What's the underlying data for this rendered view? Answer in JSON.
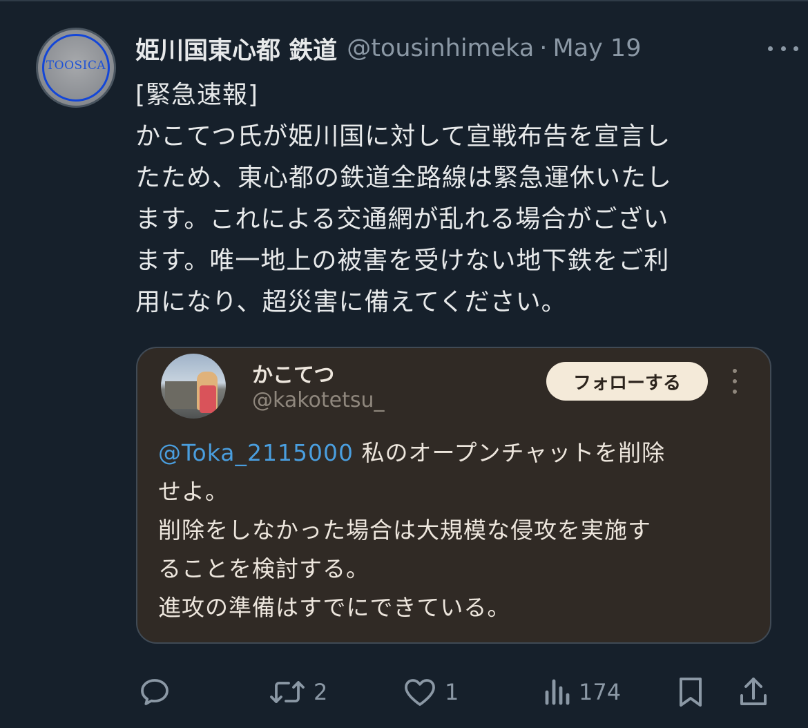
{
  "tweet": {
    "avatar_text": "TOOSICA",
    "display_name": "姫川国東心都 鉄道",
    "handle": "@tousinhimeka",
    "separator": "·",
    "date": "May 19",
    "lines": [
      "[緊急速報]",
      "かこてつ氏が姫川国に対して宣戦布告を宣言し",
      "たため、東心都の鉄道全路線は緊急運休いたし",
      "ます。これによる交通網が乱れる場合がござい",
      "ます。唯一地上の被害を受けない地下鉄をご利",
      "用になり、超災害に備えてください。"
    ]
  },
  "embed": {
    "name": "かこてつ",
    "handle": "@kakotetsu_",
    "follow_label": "フォローする",
    "mention": "@Toka_2115000",
    "first_line_rest": " 私のオープンチャットを削除",
    "lines": [
      "せよ。",
      "削除をしなかった場合は大規模な侵攻を実施す",
      "ることを検討する。",
      "進攻の準備はすでにできている。"
    ]
  },
  "actions": {
    "reply_icon": "reply-icon",
    "retweet_icon": "retweet-icon",
    "retweet_count": "2",
    "like_icon": "heart-icon",
    "like_count": "1",
    "views_icon": "views-icon",
    "views_count": "174",
    "bookmark_icon": "bookmark-icon",
    "share_icon": "share-icon"
  },
  "colors": {
    "background": "#16202b",
    "text": "#e7e9ea",
    "muted": "#8b98a5",
    "mention": "#4a9ede",
    "embed_background": "#302a25",
    "follow_button": "#f4ead9"
  }
}
